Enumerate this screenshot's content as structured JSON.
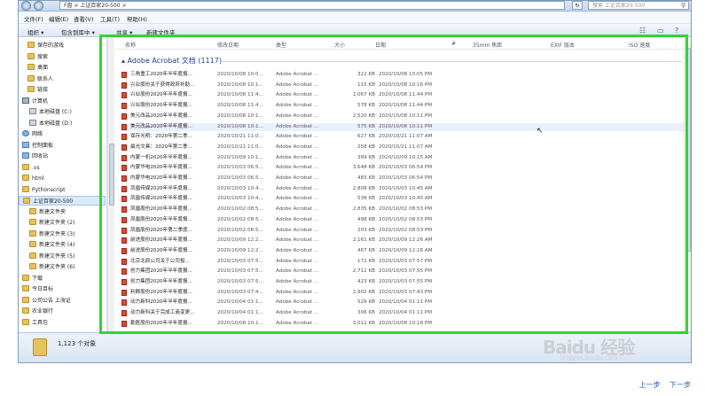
{
  "window": {
    "address": "F盘 > 上证百家20-500 >",
    "search_placeholder": "搜索 上证百家20-500"
  },
  "menubar": {
    "items": [
      "文件(F)",
      "编辑(E)",
      "查看(V)",
      "工具(T)",
      "帮助(H)"
    ]
  },
  "toolbar": {
    "organize": "组织 ▾",
    "include": "包含到库中 ▾",
    "share": "共享 ▾",
    "new_folder": "新建文件夹"
  },
  "navpane": {
    "items": [
      {
        "label": "保存的游戏",
        "icon": "folder"
      },
      {
        "label": "搜索",
        "icon": "folder"
      },
      {
        "label": "桌面",
        "icon": "folder"
      },
      {
        "label": "联系人",
        "icon": "folder"
      },
      {
        "label": "链接",
        "icon": "folder"
      },
      {
        "label": "计算机",
        "icon": "computer"
      },
      {
        "label": "本地磁盘 (C:)",
        "icon": "drive"
      },
      {
        "label": "本地磁盘 (D:)",
        "icon": "drive"
      },
      {
        "label": "网络",
        "icon": "network"
      },
      {
        "label": "控制面板",
        "icon": "library"
      },
      {
        "label": "回收站",
        "icon": "library"
      },
      {
        "label": ".vs",
        "icon": "folder"
      },
      {
        "label": "html",
        "icon": "folder"
      },
      {
        "label": "Pythonscript",
        "icon": "folder"
      },
      {
        "label": "上证百家20-500",
        "icon": "folder",
        "selected": true
      },
      {
        "label": "新建文件夹",
        "icon": "folder"
      },
      {
        "label": "新建文件夹 (2)",
        "icon": "folder"
      },
      {
        "label": "新建文件夹 (3)",
        "icon": "folder"
      },
      {
        "label": "新建文件夹 (4)",
        "icon": "folder"
      },
      {
        "label": "新建文件夹 (5)",
        "icon": "folder"
      },
      {
        "label": "新建文件夹 (6)",
        "icon": "folder"
      },
      {
        "label": "下载",
        "icon": "folder"
      },
      {
        "label": "今日目标",
        "icon": "folder"
      },
      {
        "label": "公司公告 上海证",
        "icon": "folder"
      },
      {
        "label": "农业银行",
        "icon": "folder"
      },
      {
        "label": "工具包",
        "icon": "folder"
      }
    ]
  },
  "list": {
    "headers": {
      "name": "名称",
      "date": "修改日期",
      "type": "类型",
      "size": "大小",
      "date2": "日期",
      "hash": "#",
      "focal": "35mm 焦距",
      "exif": "EXIF 版本",
      "iso": "ISO 速度"
    },
    "group_title": "Adobe Acrobat 文档 (1117)",
    "rows": [
      {
        "name": "三角重工2020年半年度报...",
        "date": "2020/10/08 10:0...",
        "type": "Adobe Acrobat ...",
        "size": "322 KB",
        "modified": "2020/10/08 10:05 PM"
      },
      {
        "name": "兴业股份关于获得政府补助...",
        "date": "2020/10/08 10:1...",
        "type": "Adobe Acrobat ...",
        "size": "115 KB",
        "modified": "2020/10/08 10:16 PM"
      },
      {
        "name": "兴业股份2020年半年度报...",
        "date": "2020/10/08 11:4...",
        "type": "Adobe Acrobat ...",
        "size": "2,067 KB",
        "modified": "2020/10/08 11:44 PM"
      },
      {
        "name": "兴业股份2020年半年度报...",
        "date": "2020/10/08 11:4...",
        "type": "Adobe Acrobat ...",
        "size": "578 KB",
        "modified": "2020/10/08 11:44 PM"
      },
      {
        "name": "美元改品2020年半年度报...",
        "date": "2020/10/08 10:1...",
        "type": "Adobe Acrobat ...",
        "size": "2,520 KB",
        "modified": "2020/10/08 10:11 PM"
      },
      {
        "name": "美元改品2020年半年度报...",
        "date": "2020/10/08 10:1...",
        "type": "Adobe Acrobat ...",
        "size": "575 KB",
        "modified": "2020/10/08 10:11 PM",
        "highlight": true
      },
      {
        "name": "保存光明：2020年第二季...",
        "date": "2020/10/21 11:0...",
        "type": "Adobe Acrobat ...",
        "size": "627 KB",
        "modified": "2020/10/21 11:07 AM"
      },
      {
        "name": "晨光文具：2020年第二季...",
        "date": "2020/10/21 11:0...",
        "type": "Adobe Acrobat ...",
        "size": "258 KB",
        "modified": "2020/10/21 11:07 AM"
      },
      {
        "name": "内蒙一机2020年半年度报...",
        "date": "2020/10/09 10:1...",
        "type": "Adobe Acrobat ...",
        "size": "389 KB",
        "modified": "2020/10/09 10:15 AM"
      },
      {
        "name": "内蒙华电2020年半年度报...",
        "date": "2020/10/03 06:5...",
        "type": "Adobe Acrobat ...",
        "size": "3,648 KB",
        "modified": "2020/10/03 06:54 PM"
      },
      {
        "name": "内蒙华电2020年半年度报...",
        "date": "2020/10/03 06:5...",
        "type": "Adobe Acrobat ...",
        "size": "483 KB",
        "modified": "2020/10/03 06:54 PM"
      },
      {
        "name": "凤凰传媒2020年半年度报...",
        "date": "2020/10/03 10:4...",
        "type": "Adobe Acrobat ...",
        "size": "2,808 KB",
        "modified": "2020/10/03 10:45 AM"
      },
      {
        "name": "凤凰传媒2020年半年度报...",
        "date": "2020/10/03 10:4...",
        "type": "Adobe Acrobat ...",
        "size": "538 KB",
        "modified": "2020/10/03 10:45 AM"
      },
      {
        "name": "凤凰股份2020年半年度报...",
        "date": "2020/10/02 08:5...",
        "type": "Adobe Acrobat ...",
        "size": "2,835 KB",
        "modified": "2020/10/02 08:53 PM"
      },
      {
        "name": "凤凰股份2020年半年度报...",
        "date": "2020/10/02 08:5...",
        "type": "Adobe Acrobat ...",
        "size": "498 KB",
        "modified": "2020/10/02 08:53 PM"
      },
      {
        "name": "凤凰股份2020年第二季度...",
        "date": "2020/10/02 08:5...",
        "type": "Adobe Acrobat ...",
        "size": "203 KB",
        "modified": "2020/10/02 08:53 PM"
      },
      {
        "name": "前进股份2020年半年度报...",
        "date": "2020/10/09 12:2...",
        "type": "Adobe Acrobat ...",
        "size": "2,161 KB",
        "modified": "2020/10/09 12:26 AM"
      },
      {
        "name": "前进股份2020年半年度报...",
        "date": "2020/10/09 12:2...",
        "type": "Adobe Acrobat ...",
        "size": "467 KB",
        "modified": "2020/10/09 12:26 AM"
      },
      {
        "name": "北京北辰公司关于公司投...",
        "date": "2020/10/03 07:5...",
        "type": "Adobe Acrobat ...",
        "size": "172 KB",
        "modified": "2020/10/03 07:57 PM"
      },
      {
        "name": "创力集团2020年半年度报...",
        "date": "2020/10/03 07:5...",
        "type": "Adobe Acrobat ...",
        "size": "2,712 KB",
        "modified": "2020/10/03 07:55 PM"
      },
      {
        "name": "创力集团2020年半年度报...",
        "date": "2020/10/03 07:5...",
        "type": "Adobe Acrobat ...",
        "size": "423 KB",
        "modified": "2020/10/03 07:55 PM"
      },
      {
        "name": "利群股份2020年半年度报...",
        "date": "2020/10/03 07:4...",
        "type": "Adobe Acrobat ...",
        "size": "2,902 KB",
        "modified": "2020/10/03 07:43 PM"
      },
      {
        "name": "动力新科2020年半年度报...",
        "date": "2020/10/04 01:1...",
        "type": "Adobe Acrobat ...",
        "size": "529 KB",
        "modified": "2020/10/04 01:11 PM"
      },
      {
        "name": "动力新科关于完成工商变更...",
        "date": "2020/10/04 01:1...",
        "type": "Adobe Acrobat ...",
        "size": "306 KB",
        "modified": "2020/10/04 01:11 PM"
      },
      {
        "name": "勤胜股份2020年半年度报...",
        "date": "2020/10/08 10:1...",
        "type": "Adobe Acrobat ...",
        "size": "3,012 KB",
        "modified": "2020/10/08 10:18 PM"
      }
    ]
  },
  "status": {
    "count": "1,123 个对象"
  },
  "pager": {
    "prev": "上一步",
    "next": "下一步"
  },
  "watermark": {
    "main": "Baidu 经验",
    "sub": "jingyan.baidu.com"
  }
}
